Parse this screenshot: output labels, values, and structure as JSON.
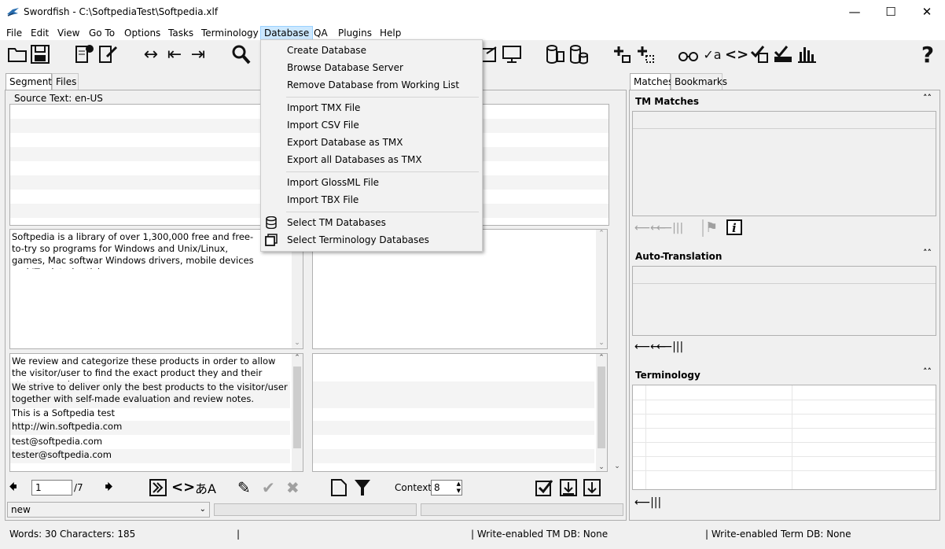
{
  "window": {
    "title": "Swordfish - C:\\SoftpediaTest\\Softpedia.xlf"
  },
  "menu": [
    "File",
    "Edit",
    "View",
    "Go To",
    "Options",
    "Tasks",
    "Terminology",
    "Database",
    "QA",
    "Plugins",
    "Help"
  ],
  "database_menu": {
    "create": "Create Database",
    "browse": "Browse Database Server",
    "remove": "Remove Database from Working List",
    "import_tmx": "Import TMX File",
    "import_csv": "Import CSV File",
    "export_tmx": "Export Database as TMX",
    "export_all": "Export all Databases as TMX",
    "import_glossml": "Import GlossML File",
    "import_tbx": "Import TBX File",
    "select_tm": "Select TM Databases",
    "select_term": "Select Terminology Databases"
  },
  "left_tabs": {
    "segments": "Segments",
    "files": "Files"
  },
  "source_label": "Source Text: en-US",
  "source_text": "Softpedia is a library of over 1,300,000 free and free-to-try so programs for Windows and Unix/Linux, games, Mac softwar Windows drivers, mobile devices and IT-related articles.",
  "segments": [
    "We review and categorize these products in order to allow the visitor/user to find the exact product they and their system needs.",
    "We strive to deliver only the best products to the visitor/user together with self-made evaluation and review notes.",
    "This is a Softpedia test",
    "http://win.softpedia.com",
    "test@softpedia.com",
    "tester@softpedia.com"
  ],
  "nav": {
    "page": "1",
    "total": "/7",
    "context_label": "Context:",
    "context_value": "8"
  },
  "status_combo": "new",
  "right_tabs": {
    "matches": "Matches",
    "bookmarks": "Bookmarks"
  },
  "right_sections": {
    "tm": "TM Matches",
    "auto": "Auto-Translation",
    "term": "Terminology"
  },
  "status_bar": {
    "words": "Words: 30 Characters: 185",
    "sep1": "|",
    "tm_db": "| Write-enabled TM DB: None",
    "term_db": "| Write-enabled Term DB: None"
  },
  "icons": [
    "app-logo-icon",
    "open-folder-icon",
    "save-icon",
    "new-document-icon",
    "edit-document-icon",
    "merge-icon",
    "split-left-icon",
    "split-right-icon",
    "search-icon",
    "export-icon",
    "preview-icon",
    "database-icon",
    "database-stack-icon",
    "add-term-icon",
    "select-term-icon",
    "glasses-icon",
    "spellcheck-icon",
    "tags-icon",
    "check-tags-icon",
    "progress-icon",
    "statistics-icon",
    "help-icon"
  ]
}
